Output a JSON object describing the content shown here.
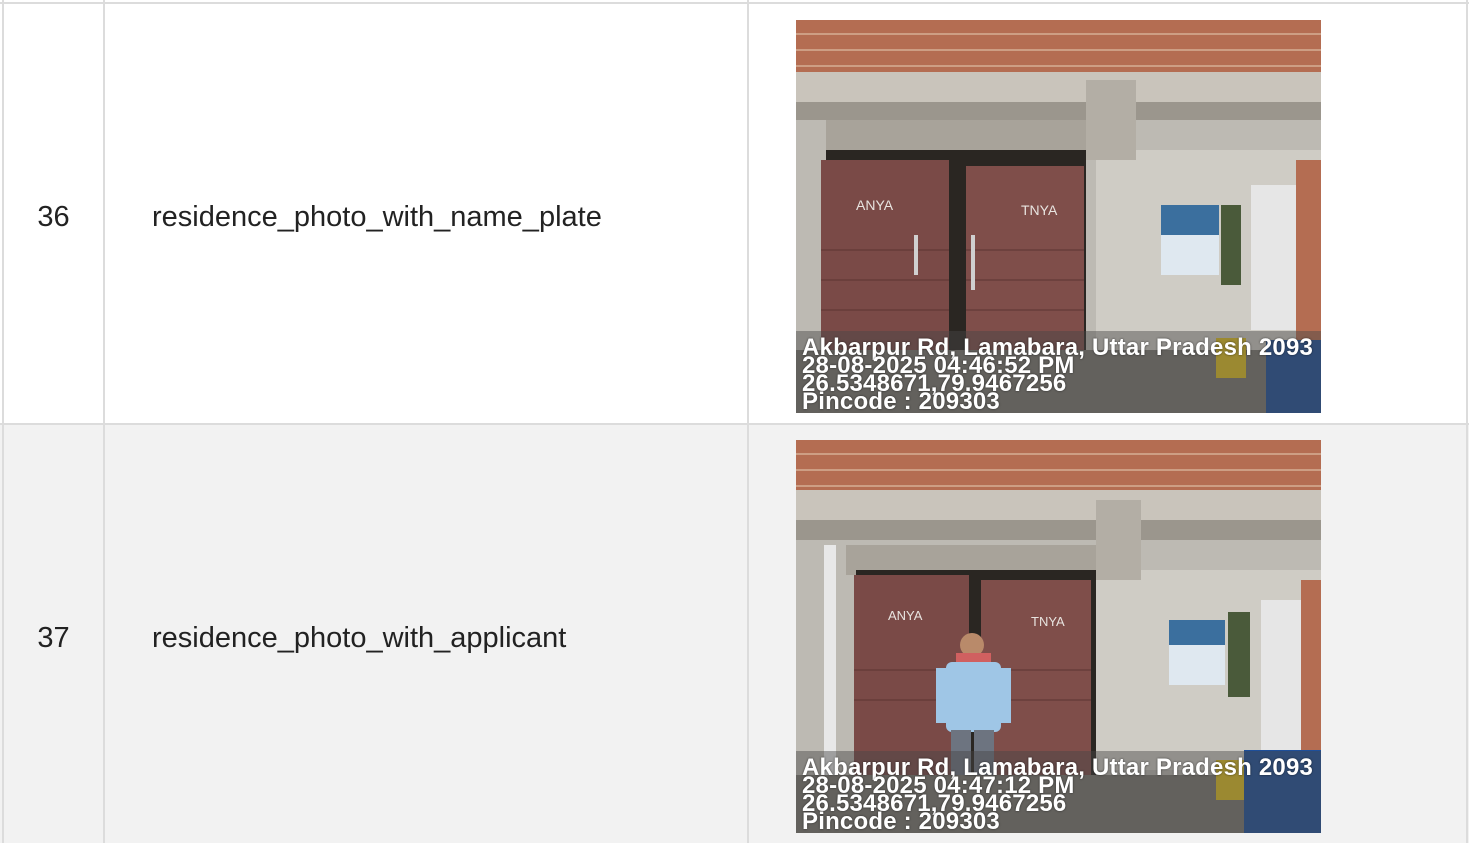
{
  "rows": [
    {
      "number": "36",
      "label": "residence_photo_with_name_plate",
      "photo": {
        "door_text_left": "ANYA",
        "door_text_right": "TNYA",
        "stamp": {
          "address": "Akbarpur Rd, Lamabara, Uttar Pradesh 2093",
          "datetime": "28-08-2025 04:46:52 PM",
          "coords": "26.5348671,79.9467256",
          "pincode": "Pincode : 209303"
        }
      }
    },
    {
      "number": "37",
      "label": "residence_photo_with_applicant",
      "photo": {
        "door_text_left": "ANYA",
        "door_text_right": "TNYA",
        "stamp": {
          "address": "Akbarpur Rd, Lamabara, Uttar Pradesh 2093",
          "datetime": "28-08-2025 04:47:12 PM",
          "coords": "26.5348671,79.9467256",
          "pincode": "Pincode : 209303"
        }
      }
    }
  ]
}
